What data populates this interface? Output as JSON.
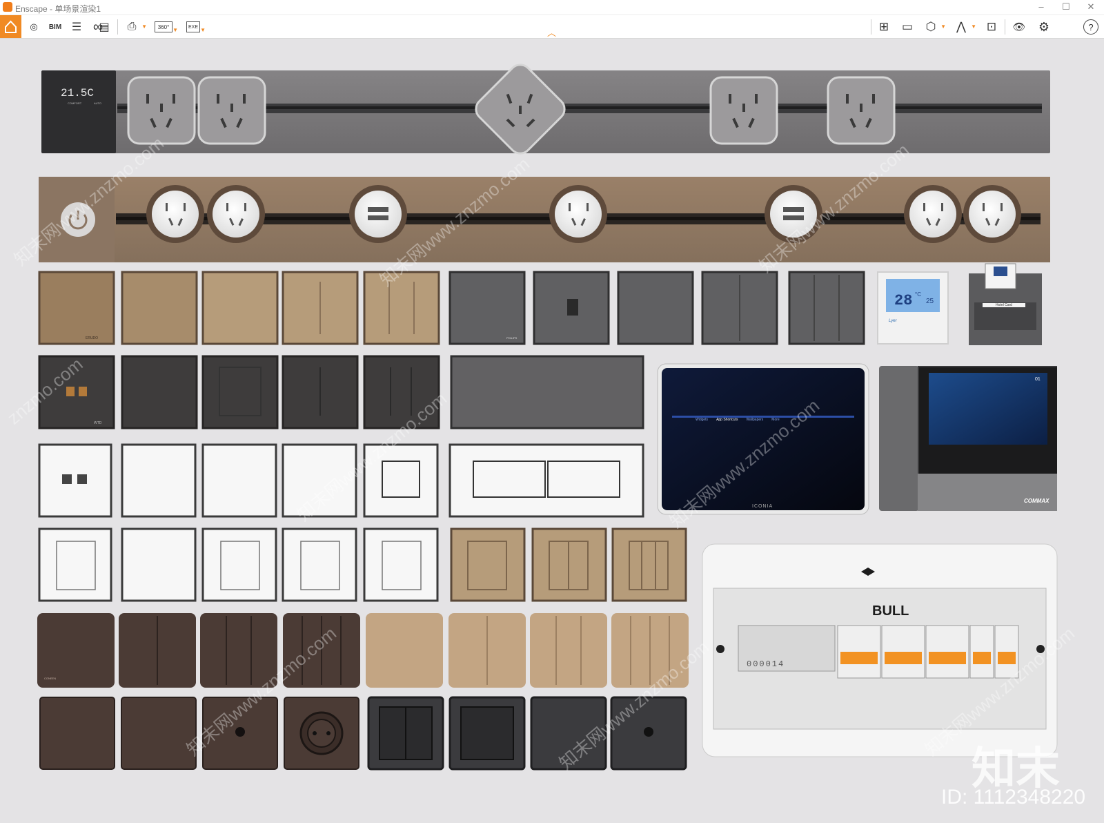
{
  "window": {
    "app_name": "Enscape",
    "separator": " - ",
    "scene": "单场景渲染1",
    "min": "–",
    "max": "☐",
    "close": "✕"
  },
  "toolbar": {
    "left": [
      {
        "label": "⌂",
        "name": "home"
      },
      {
        "label": "◎",
        "name": "views"
      },
      {
        "label": "BIM",
        "name": "bim"
      },
      {
        "label": "☰",
        "name": "settings-list"
      },
      {
        "label": "∞",
        "name": "vr"
      },
      {
        "label": "▤",
        "name": "video"
      },
      {
        "label": "⎙",
        "name": "export-image"
      },
      {
        "label": "360°",
        "name": "panorama"
      },
      {
        "label": "EXE",
        "name": "exe-export"
      }
    ],
    "right": [
      {
        "label": "⊞",
        "name": "map"
      },
      {
        "label": "▭",
        "name": "screen"
      },
      {
        "label": "⬡",
        "name": "asset"
      },
      {
        "label": "⋀",
        "name": "library"
      },
      {
        "label": "⊡",
        "name": "capture"
      },
      {
        "label": "👁",
        "name": "visual"
      },
      {
        "label": "⚙",
        "name": "gear"
      },
      {
        "label": "?",
        "name": "help"
      }
    ]
  },
  "collapse": "︿",
  "scene": {
    "thermostat_top": {
      "temp": "21.5C",
      "comfort": "COMFORT",
      "auto": "AUTO"
    },
    "thermostat_panel": {
      "big": "28",
      "unit": "°C",
      "small": "25",
      "brand": "Lyer"
    },
    "card_holder": {
      "label": "Hotel Card"
    },
    "tablet": {
      "brand": "ICONIA",
      "tabs": [
        "Widgets",
        "App Shortcuts",
        "Wallpapers",
        "More"
      ]
    },
    "intercom": {
      "brand": "COMMAX",
      "time": "01"
    },
    "breaker": {
      "brand": "BULL",
      "meter": "000014"
    },
    "brands": {
      "erdo": "ERUDO",
      "philips": "PHILIPS",
      "wtd": "WTD",
      "csv": "CONEEN"
    },
    "watermark": {
      "site": "www.znzmo.com",
      "cn": "知末网",
      "logo": "知末",
      "id": "ID: 1112348220"
    }
  },
  "colors": {
    "accent": "#f08a24",
    "bg": "#e4e3e5"
  }
}
